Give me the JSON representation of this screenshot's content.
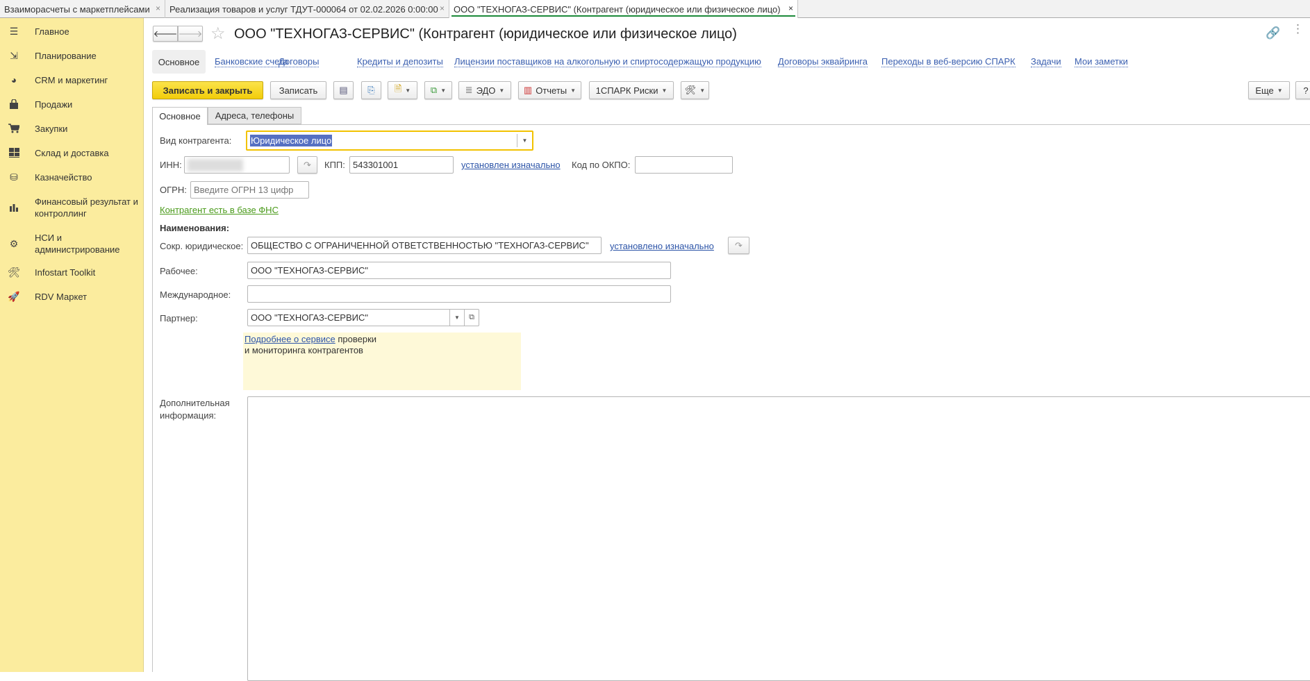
{
  "window_tabs": [
    {
      "label": "Взаиморасчеты с маркетплейсами"
    },
    {
      "label": "Реализация товаров и услуг ТДУТ-000064 от 02.02.2026 0:00:00"
    },
    {
      "label": "ООО \"ТЕХНОГАЗ-СЕРВИС\" (Контрагент (юридическое или физическое лицо)"
    }
  ],
  "close_glyph": "×",
  "sidebar": {
    "items": [
      {
        "label": "Главное",
        "icon": "menu-icon"
      },
      {
        "label": "Планирование",
        "icon": "planning-icon"
      },
      {
        "label": "CRM и маркетинг",
        "icon": "pie-chart-icon"
      },
      {
        "label": "Продажи",
        "icon": "bag-icon"
      },
      {
        "label": "Закупки",
        "icon": "cart-icon"
      },
      {
        "label": "Склад и доставка",
        "icon": "warehouse-icon"
      },
      {
        "label": "Казначейство",
        "icon": "coins-icon"
      },
      {
        "label": "Финансовый результат и контроллинг",
        "icon": "bar-chart-icon"
      },
      {
        "label": "НСИ и администрирование",
        "icon": "gear-icon"
      },
      {
        "label": "Infostart Toolkit",
        "icon": "tools-icon"
      },
      {
        "label": "RDV Маркет",
        "icon": "rocket-icon"
      }
    ]
  },
  "header": {
    "title": "ООО \"ТЕХНОГАЗ-СЕРВИС\" (Контрагент (юридическое или физическое лицо)"
  },
  "nav_links": [
    "Основное",
    "Банковские счета",
    "Договоры",
    "Кредиты и депозиты",
    "Лицензии поставщиков на алкогольную и спиртосодержащую продукцию",
    "Договоры эквайринга",
    "Переходы в веб-версию СПАРК",
    "Задачи",
    "Мои заметки"
  ],
  "toolbar": {
    "save_close": "Записать и закрыть",
    "save": "Записать",
    "edo": "ЭДО",
    "reports": "Отчеты",
    "spark": "1СПАРК Риски",
    "more": "Еще",
    "help": "?"
  },
  "form_tabs": [
    "Основное",
    "Адреса, телефоны"
  ],
  "form": {
    "kind_label": "Вид контрагента:",
    "kind_value": "Юридическое лицо",
    "inn_label": "ИНН:",
    "kpp_label": "КПП:",
    "kpp_value": "543301001",
    "kpp_status": "установлен изначально",
    "okpo_label": "Код по ОКПО:",
    "okpo_value": "",
    "ogrn_label": "ОГРН:",
    "ogrn_placeholder": "Введите ОГРН 13 цифр",
    "fns_link": "Контрагент есть в базе ФНС",
    "names_header": "Наименования:",
    "short_label": "Сокр. юридическое:",
    "short_value": "ОБЩЕСТВО С ОГРАНИЧЕННОЙ ОТВЕТСТВЕННОСТЬЮ \"ТЕХНОГАЗ-СЕРВИС\"",
    "short_status": "установлено изначально",
    "work_label": "Рабочее:",
    "work_value": "ООО \"ТЕХНОГАЗ-СЕРВИС\"",
    "intl_label": "Международное:",
    "intl_value": "",
    "partner_label": "Партнер:",
    "partner_value": "ООО \"ТЕХНОГАЗ-СЕРВИС\"",
    "info_link": "Подробнее о сервисе",
    "info_text1": " проверки",
    "info_text2": "и мониторинга контрагентов",
    "extra_label": "Дополнительная информация:",
    "extra_value": ""
  },
  "colors": {
    "sidebar": "#fbec9e",
    "primary_button": "#f5d312",
    "link": "#3a5fb0",
    "fns_link": "#4a9a1a",
    "active_tab_line": "#1c8a3a",
    "info_box": "#fef9d8",
    "focus_border": "#f2c200"
  }
}
